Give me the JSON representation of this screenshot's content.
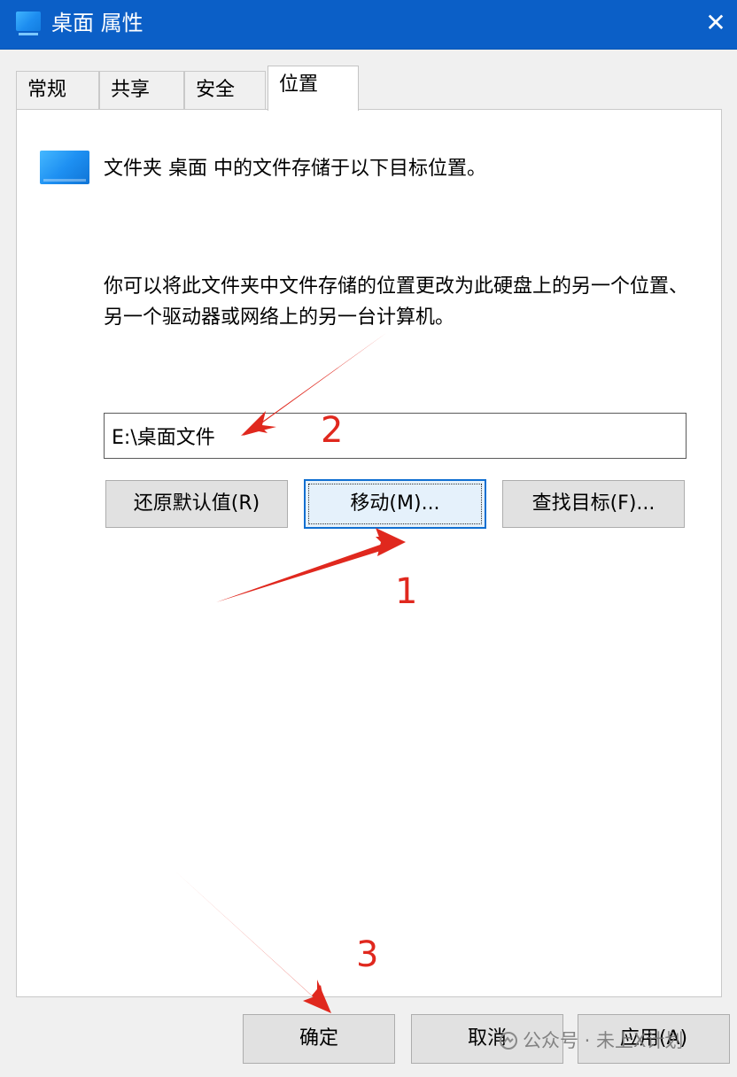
{
  "window": {
    "title": "桌面 属性",
    "close_glyph": "✕",
    "icon": "desktop-folder-icon"
  },
  "tabs": [
    {
      "label": "常规",
      "active": false
    },
    {
      "label": "共享",
      "active": false
    },
    {
      "label": "安全",
      "active": false
    },
    {
      "label": "位置",
      "active": true
    }
  ],
  "location": {
    "info_line": "文件夹 桌面 中的文件存储于以下目标位置。",
    "description": "你可以将此文件夹中文件存储的位置更改为此硬盘上的另一个位置、另一个驱动器或网络上的另一台计算机。",
    "path_value": "E:\\桌面文件",
    "buttons": {
      "restore": "还原默认值(R)",
      "move": "移动(M)...",
      "find": "查找目标(F)..."
    }
  },
  "footer": {
    "ok": "确定",
    "cancel": "取消",
    "apply": "应用(A)"
  },
  "annotations": {
    "color": "#e0281e",
    "step1": "1",
    "step2": "2",
    "step3": "3"
  },
  "watermark": {
    "text": "公众号 · 未上X计划",
    "icon": "wechat-official-account-icon"
  }
}
